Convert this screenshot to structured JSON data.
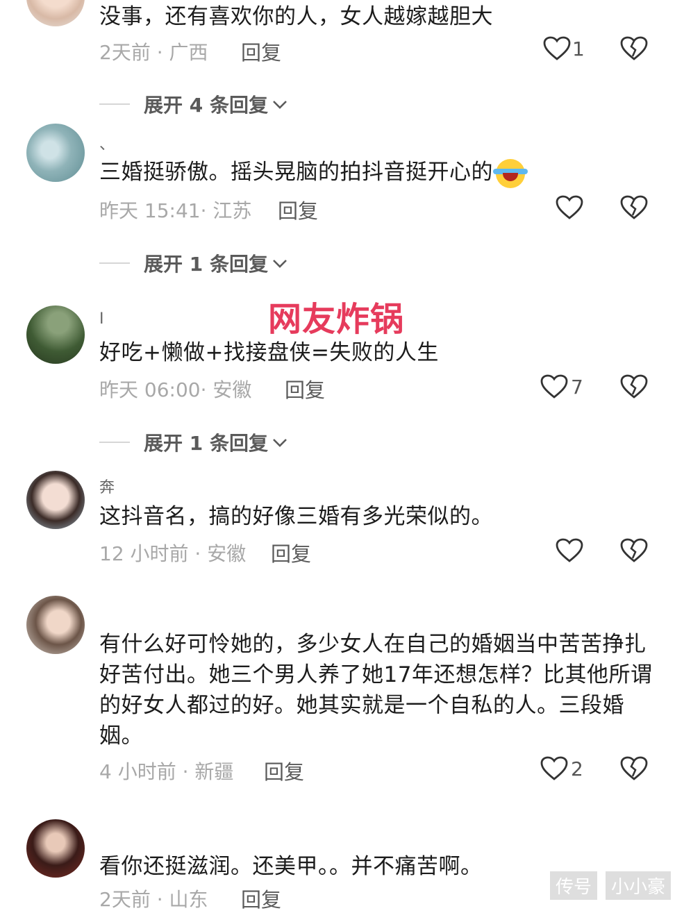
{
  "headline": "网友炸锅",
  "expand_suffix": "条回复",
  "reply_label": "回复",
  "comments": [
    {
      "username": "",
      "text": "没事，还有喜欢你的人，女人越嫁越胆大",
      "time": "2天前",
      "location": "广西",
      "likes": "1",
      "expand": "展开 4 条回复"
    },
    {
      "username": "、",
      "text": "三婚挺骄傲。摇头晃脑的拍抖音挺开心的",
      "time": "昨天 15:41",
      "location": "江苏",
      "likes": "",
      "expand": "展开 1 条回复"
    },
    {
      "username": "I",
      "text": "好吃+懒做+找接盘侠=失败的人生",
      "time": "昨天 06:00",
      "location": "安徽",
      "likes": "7",
      "expand": "展开 1 条回复"
    },
    {
      "username": "奔",
      "text": "这抖音名，搞的好像三婚有多光荣似的。",
      "time": "12 小时前",
      "location": "安徽",
      "likes": ""
    },
    {
      "username": "",
      "text": "有什么好可怜她的，多少女人在自己的婚姻当中苦苦挣扎好苦付出。她三个男人养了她17年还想怎样？比其他所谓的好女人都过的好。她其实就是一个自私的人。三段婚姻。",
      "time": "4 小时前",
      "location": "新疆",
      "likes": "2"
    },
    {
      "username": "",
      "text": "看你还挺滋润。还美甲。。并不痛苦啊。",
      "time": "2天前",
      "location": "山东",
      "likes": ""
    }
  ],
  "watermark": [
    "传号",
    "小小豪"
  ],
  "colors": {
    "headline": "#e63b5c",
    "meta": "#a8a8a8",
    "text": "#1c1c1c"
  },
  "icons": [
    "heart-outline-icon",
    "broken-heart-icon",
    "chevron-down-icon"
  ]
}
